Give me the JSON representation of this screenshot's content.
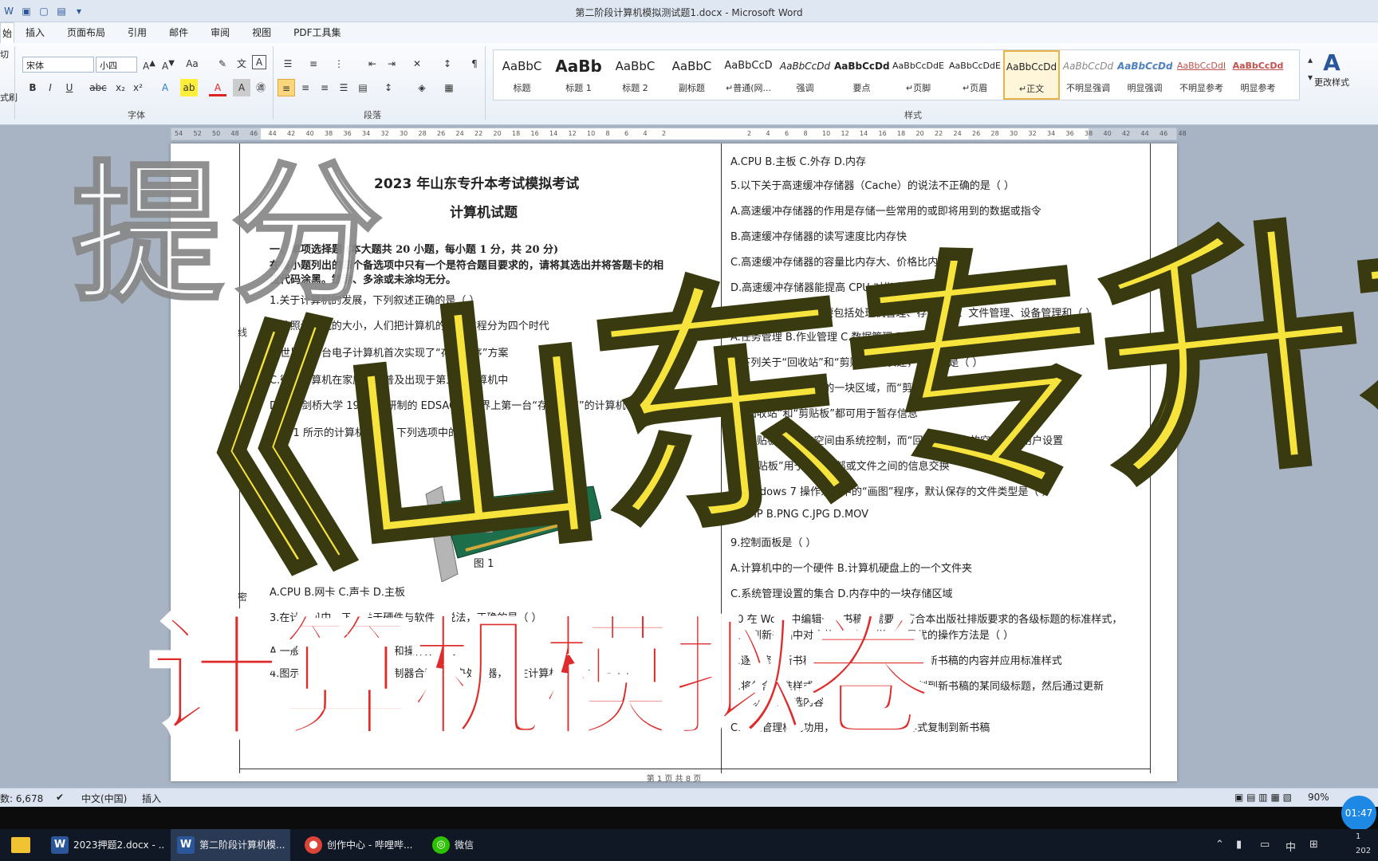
{
  "window": {
    "title": "第二阶段计算机模拟测试题1.docx - Microsoft Word"
  },
  "ribbon_tabs": [
    "始",
    "插入",
    "页面布局",
    "引用",
    "邮件",
    "审阅",
    "视图",
    "PDF工具集"
  ],
  "font": {
    "name": "宋体",
    "size": "小四"
  },
  "clipboard_labels": [
    "切",
    "式刷"
  ],
  "group_labels": {
    "font": "字体",
    "paragraph": "段落",
    "styles": "样式"
  },
  "styles": [
    {
      "preview": "AaBbC",
      "name": "标题"
    },
    {
      "preview": "AaBb",
      "name": "标题 1"
    },
    {
      "preview": "AaBbC",
      "name": "标题 2"
    },
    {
      "preview": "AaBbC",
      "name": "副标题"
    },
    {
      "preview": "AaBbCcD",
      "name": "↵普通(网..."
    },
    {
      "preview": "AaBbCcDd",
      "name": "强调"
    },
    {
      "preview": "AaBbCcDd",
      "name": "要点"
    },
    {
      "preview": "AaBbCcDdE",
      "name": "↵页脚"
    },
    {
      "preview": "AaBbCcDdE",
      "name": "↵页眉"
    },
    {
      "preview": "AaBbCcDd",
      "name": "↵正文"
    },
    {
      "preview": "AaBbCcDd",
      "name": "不明显强调"
    },
    {
      "preview": "AaBbCcDd",
      "name": "明显强调"
    },
    {
      "preview": "AaBbCcDdI",
      "name": "不明显参考"
    },
    {
      "preview": "AaBbCcDd",
      "name": "明显参考"
    }
  ],
  "change_styles": "更改样式",
  "ruler_ticks_left": [
    "54",
    "52",
    "50",
    "48",
    "46",
    "44",
    "42",
    "40",
    "38",
    "36",
    "34",
    "32",
    "30",
    "28",
    "26",
    "24",
    "22",
    "20",
    "18",
    "16",
    "14",
    "12",
    "10",
    "8",
    "6",
    "4",
    "2"
  ],
  "ruler_ticks_right": [
    "2",
    "4",
    "6",
    "8",
    "10",
    "12",
    "14",
    "16",
    "18",
    "20",
    "22",
    "24",
    "26",
    "28",
    "30",
    "32",
    "34",
    "36",
    "38",
    "40",
    "42",
    "44",
    "46",
    "48"
  ],
  "document": {
    "title": "2023 年山东专升本考试模拟考试",
    "subtitle": "计算机试题",
    "binding_marks": [
      "线",
      "封",
      "密"
    ],
    "left_col": [
      "一、单项选择题 (本大题共 20 小题，每小题 1 分，共 20 分)",
      "在每小题列出的四个备选项中只有一个是符合题目要求的，请将其选出并将答题卡的相",
      "应代码涂黑。错涂、多涂或未涂均无分。",
      "1.关于计算机的发展，下列叙述正确的是（    ）",
      "A.按照计算机的大小，人们把计算机的发展过程分为四个时代",
      "B.世界第一台电子计算机首次实现了“存储程序”方案",
      "C.微型计算机在家庭中的普及出现于第三代计算机中",
      "D.英国剑桥大学 1949 年研制的 EDSAC,是世界上第一台“存储程序”的计算机",
      "2.图 1 所示的计算机部件，下列选项中的（ ）。",
      "图    1",
      "A.CPU              B.网卡             C.声卡             D.主板",
      "3.在计算机中，下列关于硬件与软件的说法，正确的是（    ）",
      "A.一般而言，指令由操作码和操作数构成",
      "4.图示计算机中运算器和控制器合称为中央处理器，其在计算机中的作用是（    ）"
    ],
    "right_col": [
      "A.CPU          B.主板          C.外存          D.内存",
      "5.以下关于高速缓冲存储器（Cache）的说法不正确的是（            ）",
      "A.高速缓冲存储器的作用是存储一些常用的或即将用到的数据或指令",
      "B.高速缓冲存储器的读写速度比内存快",
      "C.高速缓冲存储器的容量比内存大、价格比内存高",
      "D.高速缓冲存储器能提高 CPU 对指令的处理速度",
      "6.操作系统的功能主要包括处理机管理、存储管理、文件管理、设备管理和（      ）",
      "A.任务管理          B.作业管理          C.数据管理          D.信息管理",
      "7.下列关于“回收站”和“剪贴板”的表述，正确的是（    ）",
      "A.“回收站”是硬盘中的一块区域，而“剪贴板”是内存中的一块区域",
      "B.“回收站”和“剪贴板”都可用于暂存信息",
      "C.“剪贴板”所占的空间由系统控制，而“回收站”所占的空间可由用户设置",
      "D.“剪贴板”用于文件内部或文件之间的信息交换",
      "8.Windows 7 操作系统中的“画图”程序，默认保存的文件类型是（    ）",
      "A.BMP          B.PNG          C.JPG          D.MOV",
      "9.控制面板是（    ）",
      "A.计算机中的一个硬件          B.计算机硬盘上的一个文件夹",
      "C.系统管理设置的集合          D.内存中的一块存储区域",
      "10.在 Word 中编辑一篇书稿，需要将符合本出版社排版要求的各级标题的标准样式，",
      "应用到新书稿中对应的各级标题样式，最优的操作方法是（    ）",
      "A.逐个修改新书稿中各级标题的样式，复制新书稿的内容并应用标准样式",
      "B.将包含标准样式的文档中的各级标题复制到新书稿的某同级标题，然后通过更新",
      "样式以匹配所选内容",
      "C.通过管理样式功用，将书稿中的标准样式复制到新书稿"
    ],
    "figure_caption": "图    1",
    "page_footer": "第 1 页 共 8 页"
  },
  "overlay": {
    "small": "提分",
    "big": "《山东专升本",
    "red": "计算机模拟卷"
  },
  "status_bar": {
    "word_count": "数: 6,678",
    "language": "中文(中国)",
    "mode": "插入",
    "zoom": "90%"
  },
  "timer": "01:47",
  "taskbar": {
    "items": [
      {
        "label": "2023押题2.docx - ...",
        "icon": "word-icon"
      },
      {
        "label": "第二阶段计算机模...",
        "icon": "word-icon"
      },
      {
        "label": "创作中心 - 哔哩哔...",
        "icon": "chrome-icon"
      },
      {
        "label": "微信",
        "icon": "wechat-icon"
      }
    ],
    "tray": {
      "ime": "中",
      "clock_time": "1",
      "clock_date": "202"
    }
  },
  "colors": {
    "overlay_yellow": "#f6e33c",
    "overlay_red": "#e02b2b",
    "word_blue": "#2b579a"
  }
}
